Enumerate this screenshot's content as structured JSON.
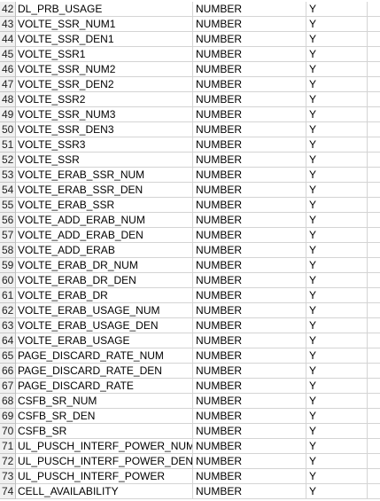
{
  "sheet": {
    "rows": [
      {
        "num": "42",
        "name": "DL_PRB_USAGE",
        "type": "NUMBER",
        "flag": "Y"
      },
      {
        "num": "43",
        "name": "VOLTE_SSR_NUM1",
        "type": "NUMBER",
        "flag": "Y"
      },
      {
        "num": "44",
        "name": "VOLTE_SSR_DEN1",
        "type": "NUMBER",
        "flag": "Y"
      },
      {
        "num": "45",
        "name": "VOLTE_SSR1",
        "type": "NUMBER",
        "flag": "Y"
      },
      {
        "num": "46",
        "name": "VOLTE_SSR_NUM2",
        "type": "NUMBER",
        "flag": "Y"
      },
      {
        "num": "47",
        "name": "VOLTE_SSR_DEN2",
        "type": "NUMBER",
        "flag": "Y"
      },
      {
        "num": "48",
        "name": "VOLTE_SSR2",
        "type": "NUMBER",
        "flag": "Y"
      },
      {
        "num": "49",
        "name": "VOLTE_SSR_NUM3",
        "type": "NUMBER",
        "flag": "Y"
      },
      {
        "num": "50",
        "name": "VOLTE_SSR_DEN3",
        "type": "NUMBER",
        "flag": "Y"
      },
      {
        "num": "51",
        "name": "VOLTE_SSR3",
        "type": "NUMBER",
        "flag": "Y"
      },
      {
        "num": "52",
        "name": "VOLTE_SSR",
        "type": "NUMBER",
        "flag": "Y"
      },
      {
        "num": "53",
        "name": "VOLTE_ERAB_SSR_NUM",
        "type": "NUMBER",
        "flag": "Y"
      },
      {
        "num": "54",
        "name": "VOLTE_ERAB_SSR_DEN",
        "type": "NUMBER",
        "flag": "Y"
      },
      {
        "num": "55",
        "name": "VOLTE_ERAB_SSR",
        "type": "NUMBER",
        "flag": "Y"
      },
      {
        "num": "56",
        "name": "VOLTE_ADD_ERAB_NUM",
        "type": "NUMBER",
        "flag": "Y"
      },
      {
        "num": "57",
        "name": "VOLTE_ADD_ERAB_DEN",
        "type": "NUMBER",
        "flag": "Y"
      },
      {
        "num": "58",
        "name": "VOLTE_ADD_ERAB",
        "type": "NUMBER",
        "flag": "Y"
      },
      {
        "num": "59",
        "name": "VOLTE_ERAB_DR_NUM",
        "type": "NUMBER",
        "flag": "Y"
      },
      {
        "num": "60",
        "name": "VOLTE_ERAB_DR_DEN",
        "type": "NUMBER",
        "flag": "Y"
      },
      {
        "num": "61",
        "name": "VOLTE_ERAB_DR",
        "type": "NUMBER",
        "flag": "Y"
      },
      {
        "num": "62",
        "name": "VOLTE_ERAB_USAGE_NUM",
        "type": "NUMBER",
        "flag": "Y"
      },
      {
        "num": "63",
        "name": "VOLTE_ERAB_USAGE_DEN",
        "type": "NUMBER",
        "flag": "Y"
      },
      {
        "num": "64",
        "name": "VOLTE_ERAB_USAGE",
        "type": "NUMBER",
        "flag": "Y"
      },
      {
        "num": "65",
        "name": "PAGE_DISCARD_RATE_NUM",
        "type": "NUMBER",
        "flag": "Y"
      },
      {
        "num": "66",
        "name": "PAGE_DISCARD_RATE_DEN",
        "type": "NUMBER",
        "flag": "Y"
      },
      {
        "num": "67",
        "name": "PAGE_DISCARD_RATE",
        "type": "NUMBER",
        "flag": "Y"
      },
      {
        "num": "68",
        "name": "CSFB_SR_NUM",
        "type": "NUMBER",
        "flag": "Y"
      },
      {
        "num": "69",
        "name": "CSFB_SR_DEN",
        "type": "NUMBER",
        "flag": "Y"
      },
      {
        "num": "70",
        "name": "CSFB_SR",
        "type": "NUMBER",
        "flag": "Y"
      },
      {
        "num": "71",
        "name": "UL_PUSCH_INTERF_POWER_NUM",
        "type": "NUMBER",
        "flag": "Y"
      },
      {
        "num": "72",
        "name": "UL_PUSCH_INTERF_POWER_DEN",
        "type": "NUMBER",
        "flag": "Y"
      },
      {
        "num": "73",
        "name": "UL_PUSCH_INTERF_POWER",
        "type": "NUMBER",
        "flag": "Y"
      },
      {
        "num": "74",
        "name": "CELL_AVAILABILITY",
        "type": "NUMBER",
        "flag": "Y"
      }
    ]
  }
}
